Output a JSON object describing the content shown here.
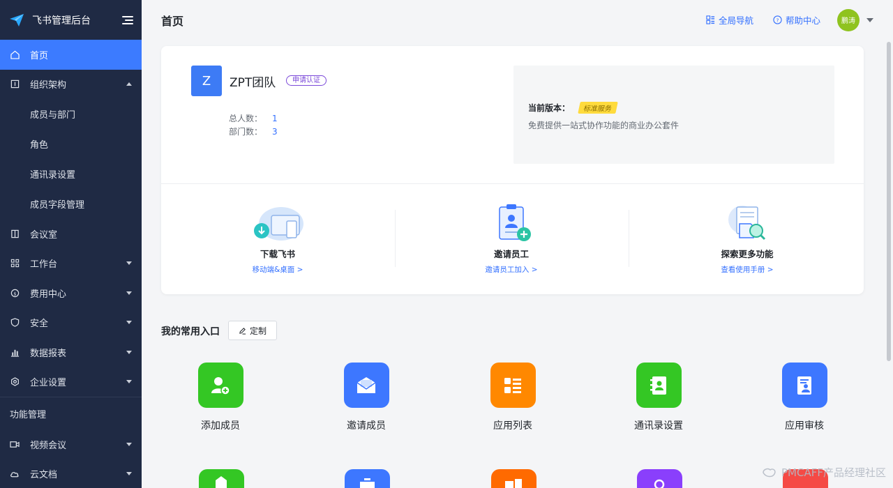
{
  "app": {
    "title": "飞书管理后台"
  },
  "sidebar": {
    "items": [
      {
        "label": "首页"
      },
      {
        "label": "组织架构"
      },
      {
        "label": "成员与部门"
      },
      {
        "label": "角色"
      },
      {
        "label": "通讯录设置"
      },
      {
        "label": "成员字段管理"
      },
      {
        "label": "会议室"
      },
      {
        "label": "工作台"
      },
      {
        "label": "费用中心"
      },
      {
        "label": "安全"
      },
      {
        "label": "数据报表"
      },
      {
        "label": "企业设置"
      }
    ],
    "section": "功能管理",
    "section_items": [
      {
        "label": "视频会议"
      },
      {
        "label": "云文档"
      }
    ]
  },
  "header": {
    "page_title": "首页",
    "global_nav": "全局导航",
    "help": "帮助中心",
    "avatar_text": "鹏涛"
  },
  "team": {
    "initial": "Z",
    "name": "ZPT团队",
    "cert": "申请认证",
    "total_label": "总人数：",
    "total_value": "1",
    "dept_label": "部门数：",
    "dept_value": "3"
  },
  "version": {
    "label": "当前版本：",
    "tag": "标准服务",
    "desc": "免费提供一站式协作功能的商业办公套件"
  },
  "features": [
    {
      "title": "下载飞书",
      "link": "移动端&桌面 >"
    },
    {
      "title": "邀请员工",
      "link": "邀请员工加入 >"
    },
    {
      "title": "探索更多功能",
      "link": "查看使用手册 >"
    }
  ],
  "quick": {
    "title": "我的常用入口",
    "custom": "定制",
    "entries": [
      {
        "name": "添加成员",
        "color": "#34c724"
      },
      {
        "name": "邀请成员",
        "color": "#3d77ff"
      },
      {
        "name": "应用列表",
        "color": "#ff8800"
      },
      {
        "name": "通讯录设置",
        "color": "#34c724"
      },
      {
        "name": "应用审核",
        "color": "#3d77ff"
      }
    ],
    "partial_colors": [
      "#34c724",
      "#3d77ff",
      "#ff6a00",
      "#8a3ffc",
      "#f54a45"
    ]
  },
  "watermark": "PMCAFF产品经理社区",
  "colors": {
    "sidebar_bg": "#1f2a44",
    "accent": "#3370ff"
  }
}
